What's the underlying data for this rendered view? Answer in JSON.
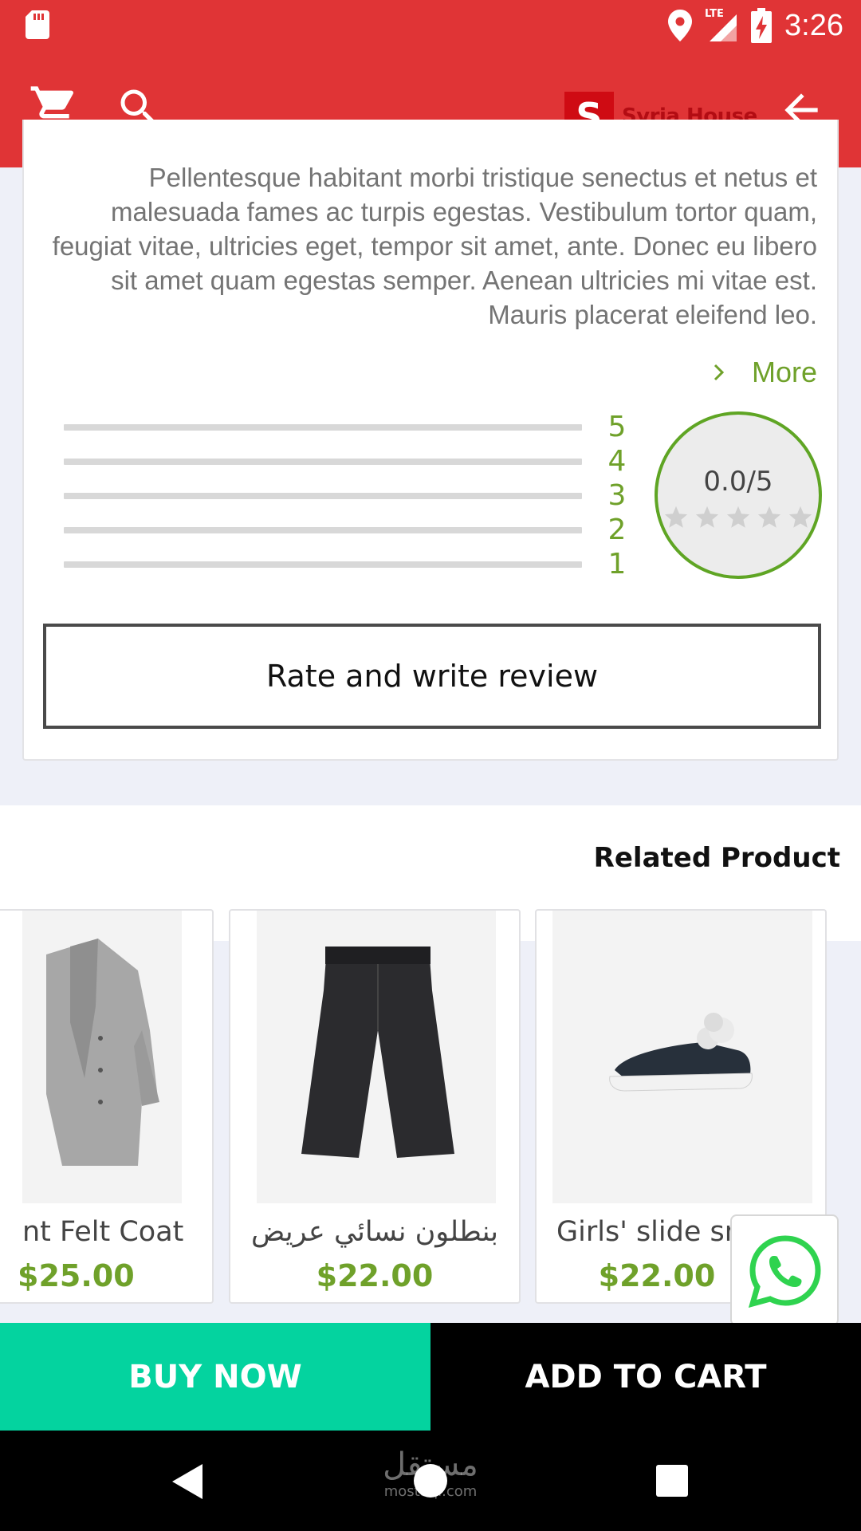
{
  "status_bar": {
    "time": "3:26",
    "network": "LTE",
    "icons": [
      "sd-card-icon",
      "location-icon",
      "signal-icon",
      "battery-charging-icon"
    ]
  },
  "app_bar": {
    "brand_letter": "S",
    "brand_name": "Syria House",
    "icons": [
      "cart-icon",
      "search-icon",
      "arrow-back-icon"
    ],
    "color": "#e03436"
  },
  "description": {
    "text": "Pellentesque habitant morbi tristique senectus et netus et malesuada fames ac turpis egestas. Vestibulum tortor quam, feugiat vitae, ultricies eget, tempor sit amet, ante. Donec eu libero sit amet quam egestas semper. Aenean ultricies mi vitae est. Mauris placerat eleifend leo.",
    "more_label": "More"
  },
  "rating": {
    "bars": [
      {
        "label": "5",
        "fraction": 0
      },
      {
        "label": "4",
        "fraction": 0
      },
      {
        "label": "3",
        "fraction": 0
      },
      {
        "label": "2",
        "fraction": 0
      },
      {
        "label": "1",
        "fraction": 0
      }
    ],
    "score": "0.0/5",
    "stars_filled": 0,
    "stars_total": 5,
    "accent_color": "#6fa12a"
  },
  "review_button": {
    "label": "Rate and write review"
  },
  "related": {
    "title": "Related Product",
    "products": [
      {
        "name": "nt Felt Coat",
        "price": "$25.00",
        "image": "grey-coat"
      },
      {
        "name": "بنطلون نسائي عريض",
        "price": "$22.00",
        "image": "black-trousers"
      },
      {
        "name": "Girls' slide sne",
        "price": "$22.00",
        "image": "slip-on-sneaker"
      }
    ]
  },
  "whatsapp": {
    "icon": "whatsapp-icon",
    "color": "#2fd34f"
  },
  "actions": {
    "buy_now": "BUY NOW",
    "add_to_cart": "ADD TO CART",
    "buy_color": "#04d39f"
  },
  "watermark": {
    "arabic": "مستقل",
    "latin": "mostaql.com"
  }
}
